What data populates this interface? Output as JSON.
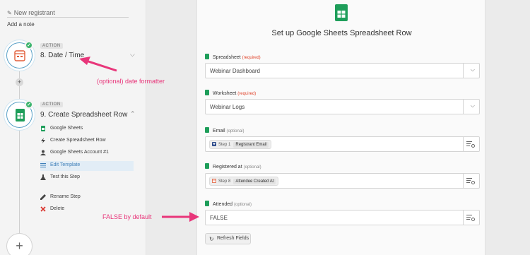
{
  "sidebar": {
    "new_registrant": "New registrant",
    "add_note": "Add a note",
    "step8": {
      "badge": "ACTION",
      "title": "8. Date / Time"
    },
    "step9": {
      "badge": "ACTION",
      "title": "9. Create Spreadsheet Row"
    },
    "sub_items": [
      {
        "label": "Google Sheets",
        "icon": "sheets-icon"
      },
      {
        "label": "Create Spreadsheet Row",
        "icon": "bolt-icon"
      },
      {
        "label": "Google Sheets Account #1",
        "icon": "user-icon"
      },
      {
        "label": "Edit Template",
        "icon": "list-icon",
        "active": true
      },
      {
        "label": "Test this Step",
        "icon": "flask-icon"
      },
      {
        "label": "Rename Step",
        "icon": "pencil-icon"
      },
      {
        "label": "Delete",
        "icon": "x-icon"
      }
    ]
  },
  "panel": {
    "title": "Set up Google Sheets Spreadsheet Row",
    "fields": {
      "spreadsheet": {
        "label": "Spreadsheet",
        "tag": "(required)",
        "value": "Webinar Dashboard"
      },
      "worksheet": {
        "label": "Worksheet",
        "tag": "(required)",
        "value": "Webinar Logs"
      },
      "email": {
        "label": "Email",
        "tag": "(optional)",
        "step": "Step 1",
        "token": "Registrant Email"
      },
      "registered_at": {
        "label": "Registered at",
        "tag": "(optional)",
        "step": "Step 8",
        "token": "Attendee Created At"
      },
      "attended": {
        "label": "Attended",
        "tag": "(optional)",
        "value": "FALSE"
      }
    },
    "refresh_label": "Refresh Fields"
  },
  "annotations": {
    "date_formatter": "(optional) date formatter",
    "false_default": "FALSE by default"
  },
  "colors": {
    "accent_blue": "#5ba1c7",
    "check_green": "#3bb46c",
    "sheets_green": "#1e9e5a",
    "annotation_pink": "#e8367a",
    "required_red": "#e0442b"
  }
}
